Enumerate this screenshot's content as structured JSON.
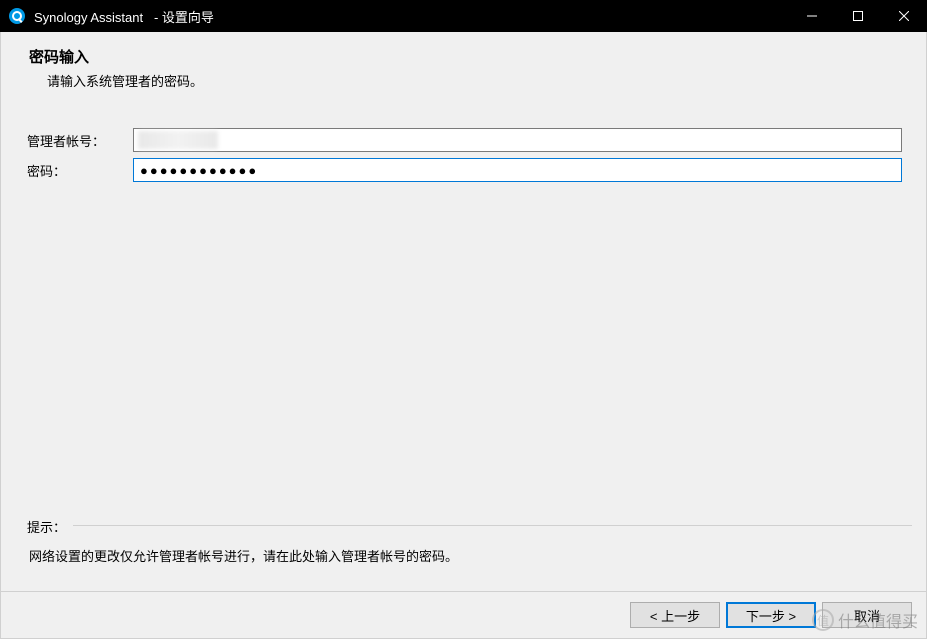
{
  "window": {
    "app_name": "Synology Assistant",
    "title_suffix": "- 设置向导"
  },
  "header": {
    "title": "密码输入",
    "subtitle": "请输入系统管理者的密码。"
  },
  "form": {
    "username_label": "管理者帐号：",
    "username_value": "",
    "password_label": "密码：",
    "password_value": "●●●●●●●●●●●●"
  },
  "hint": {
    "label": "提示：",
    "text": "网络设置的更改仅允许管理者帐号进行，请在此处输入管理者帐号的密码。"
  },
  "buttons": {
    "back": "< 上一步",
    "next": "下一步 >",
    "cancel": "取消"
  },
  "watermark": {
    "text": "什么值得买"
  }
}
